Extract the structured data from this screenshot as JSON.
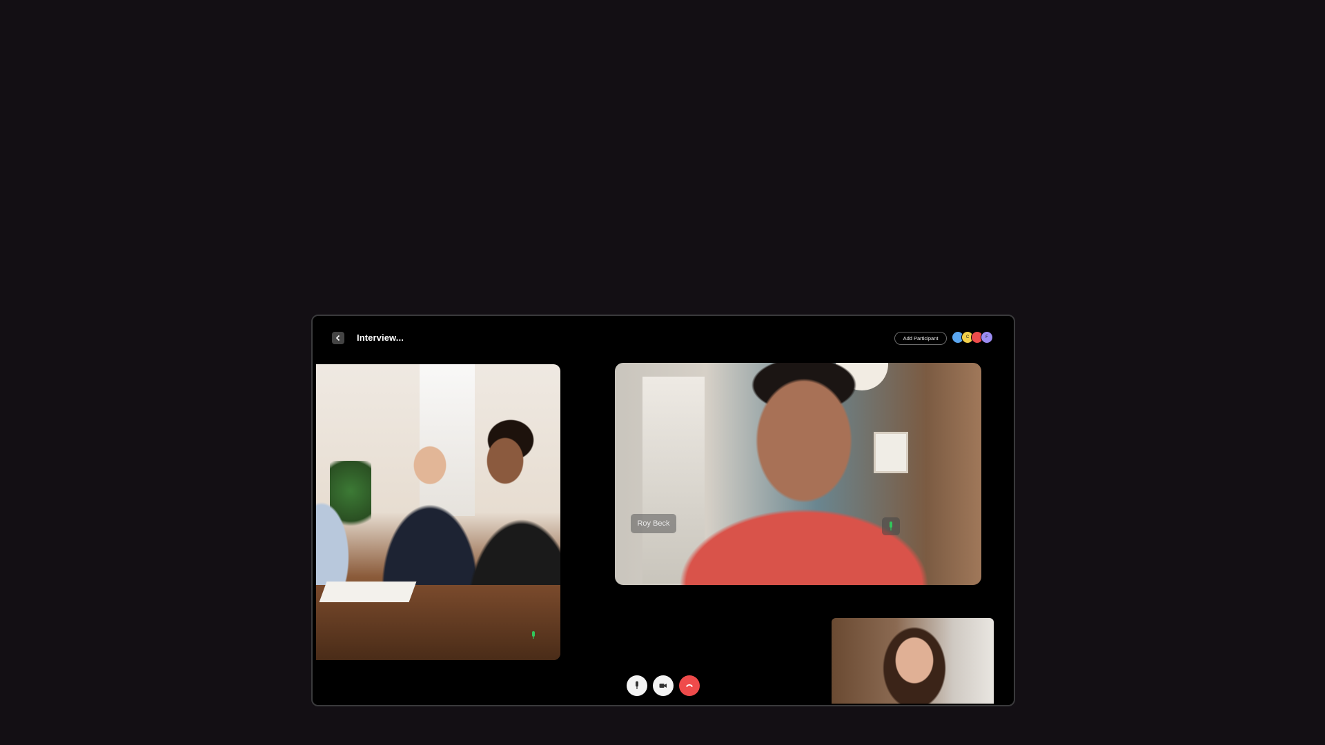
{
  "header": {
    "title": "Interview...",
    "add_participant_label": "Add Participant",
    "participant_avatars": [
      {
        "color": "#5aa6f0",
        "initial": ""
      },
      {
        "color": "#f2d04b",
        "initial": "C"
      },
      {
        "color": "#ee4c4c",
        "initial": ""
      },
      {
        "color": "#9b8cf2",
        "initial": "F"
      }
    ]
  },
  "tiles": {
    "main": {
      "name": "Roy Beck",
      "mic": "on"
    },
    "group": {
      "mic": "on"
    },
    "self": {}
  },
  "controls": [
    {
      "name": "mic",
      "icon": "mic-icon"
    },
    {
      "name": "camera",
      "icon": "video-icon"
    },
    {
      "name": "end-call",
      "icon": "phone-hangup-icon",
      "color": "#ef4b4b"
    }
  ],
  "colors": {
    "background": "#130f14",
    "device": "#000000",
    "mic_active": "#31c65b",
    "end_call": "#ef4b4b"
  }
}
